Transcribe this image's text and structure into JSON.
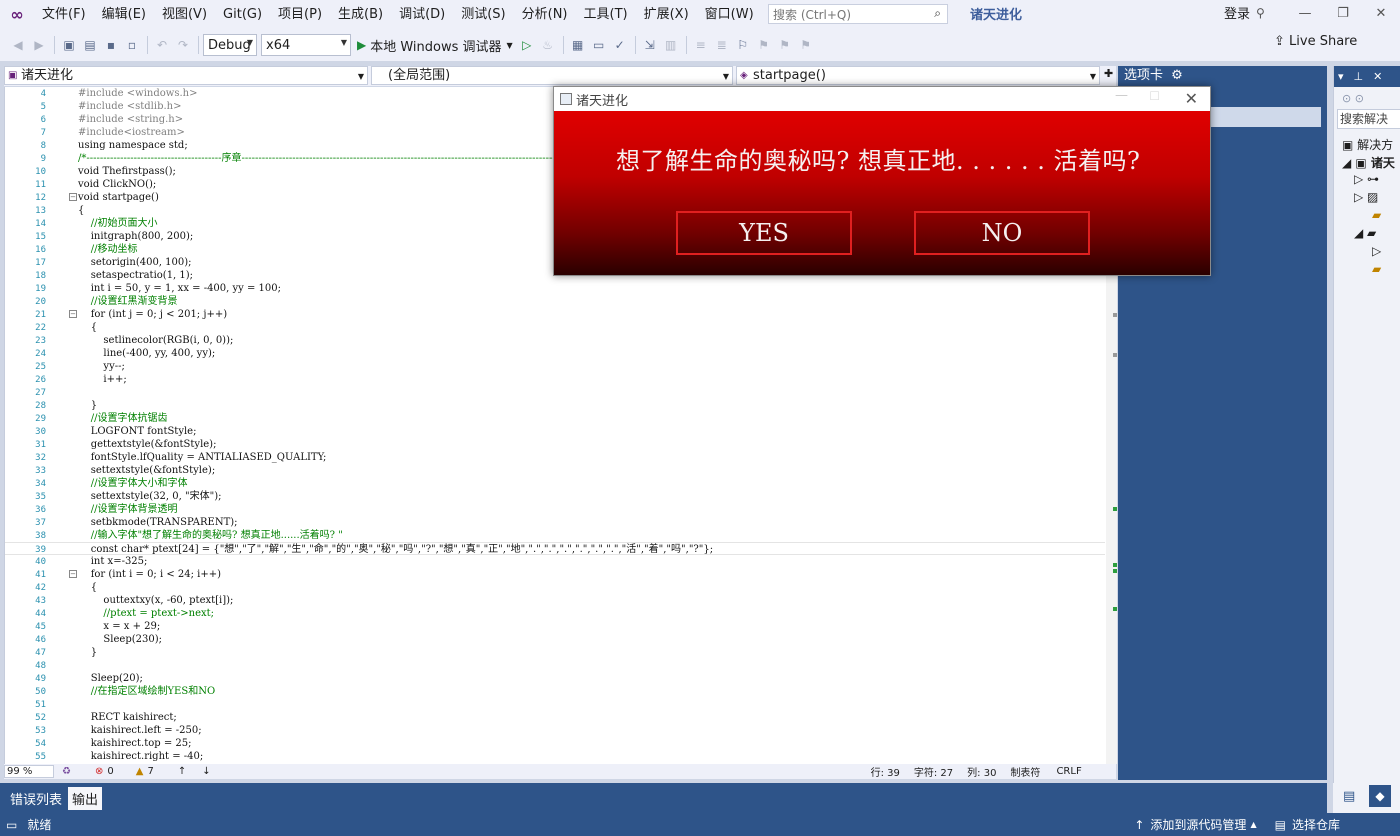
{
  "menubar": {
    "items": [
      "文件(F)",
      "编辑(E)",
      "视图(V)",
      "Git(G)",
      "项目(P)",
      "生成(B)",
      "调试(D)",
      "测试(S)",
      "分析(N)",
      "工具(T)",
      "扩展(X)",
      "窗口(W)",
      "帮助(H)"
    ],
    "search_placeholder": "搜索 (Ctrl+Q)",
    "solution_title": "诸天进化",
    "login_label": "登录"
  },
  "toolbar": {
    "config": "Debug",
    "platform": "x64",
    "run_label": "本地 Windows 调试器",
    "live_share": "Live Share"
  },
  "nav": {
    "project": "诸天进化",
    "scope": "(全局范围)",
    "member": "startpage()"
  },
  "code": {
    "current_line": 39,
    "lines": [
      {
        "n": "4",
        "t": "#include <windows.h>"
      },
      {
        "n": "5",
        "t": "#include <stdlib.h>"
      },
      {
        "n": "6",
        "t": "#include <string.h>"
      },
      {
        "n": "7",
        "t": "#include<iostream>"
      },
      {
        "n": "8",
        "t": "using namespace std;"
      },
      {
        "n": "9",
        "t": "/*----------------------------------------序章------------------------------------------------------------------------------------------------------------"
      },
      {
        "n": "10",
        "t": "void Thefirstpass();"
      },
      {
        "n": "11",
        "t": "void ClickNO();"
      },
      {
        "n": "12",
        "t": "void startpage()"
      },
      {
        "n": "13",
        "t": "{"
      },
      {
        "n": "14",
        "t": "    //初始页面大小"
      },
      {
        "n": "15",
        "t": "    initgraph(800, 200);"
      },
      {
        "n": "16",
        "t": "    //移动坐标"
      },
      {
        "n": "17",
        "t": "    setorigin(400, 100);"
      },
      {
        "n": "18",
        "t": "    setaspectratio(1, 1);"
      },
      {
        "n": "19",
        "t": "    int i = 50, y = 1, xx = -400, yy = 100;"
      },
      {
        "n": "20",
        "t": "    //设置红黑渐变背景"
      },
      {
        "n": "21",
        "t": "    for (int j = 0; j < 201; j++)"
      },
      {
        "n": "22",
        "t": "    {"
      },
      {
        "n": "23",
        "t": "        setlinecolor(RGB(i, 0, 0));"
      },
      {
        "n": "24",
        "t": "        line(-400, yy, 400, yy);"
      },
      {
        "n": "25",
        "t": "        yy--;"
      },
      {
        "n": "26",
        "t": "        i++;"
      },
      {
        "n": "27",
        "t": ""
      },
      {
        "n": "28",
        "t": "    }"
      },
      {
        "n": "29",
        "t": "    //设置字体抗锯齿"
      },
      {
        "n": "30",
        "t": "    LOGFONT fontStyle;"
      },
      {
        "n": "31",
        "t": "    gettextstyle(&fontStyle);"
      },
      {
        "n": "32",
        "t": "    fontStyle.lfQuality = ANTIALIASED_QUALITY;"
      },
      {
        "n": "33",
        "t": "    settextstyle(&fontStyle);"
      },
      {
        "n": "34",
        "t": "    //设置字体大小和字体"
      },
      {
        "n": "35",
        "t": "    settextstyle(32, 0, \"宋体\");"
      },
      {
        "n": "36",
        "t": "    //设置字体背景透明"
      },
      {
        "n": "37",
        "t": "    setbkmode(TRANSPARENT);"
      },
      {
        "n": "38",
        "t": "    //输入字体\"想了解生命的奥秘吗? 想真正地......活着吗? \""
      },
      {
        "n": "39",
        "t": "    const char* ptext[24] = {\"想\",\"了\",\"解\",\"生\",\"命\",\"的\",\"奥\",\"秘\",\"吗\",\"?\",\"想\",\"真\",\"正\",\"地\",\".\",\".\",\".\",\".\",\".\",\".\",\"活\",\"着\",\"吗\",\"?\"};"
      },
      {
        "n": "40",
        "t": "    int x=-325;"
      },
      {
        "n": "41",
        "t": "    for (int i = 0; i < 24; i++)"
      },
      {
        "n": "42",
        "t": "    {"
      },
      {
        "n": "43",
        "t": "        outtextxy(x, -60, ptext[i]);"
      },
      {
        "n": "44",
        "t": "        //ptext = ptext->next;"
      },
      {
        "n": "45",
        "t": "        x = x + 29;"
      },
      {
        "n": "46",
        "t": "        Sleep(230);"
      },
      {
        "n": "47",
        "t": "    }"
      },
      {
        "n": "48",
        "t": ""
      },
      {
        "n": "49",
        "t": "    Sleep(20);"
      },
      {
        "n": "50",
        "t": "    //在指定区域绘制YES和NO"
      },
      {
        "n": "51",
        "t": ""
      },
      {
        "n": "52",
        "t": "    RECT kaishirect;"
      },
      {
        "n": "53",
        "t": "    kaishirect.left = -250;"
      },
      {
        "n": "54",
        "t": "    kaishirect.top = 25;"
      },
      {
        "n": "55",
        "t": "    kaishirect.right = -40;"
      }
    ]
  },
  "editor_status": {
    "zoom": "99 %",
    "errors": "0",
    "warnings": "7",
    "line": "行: 39",
    "char": "字符: 27",
    "col": "列: 30",
    "tabs": "制表符",
    "eol": "CRLF"
  },
  "side_panel": {
    "tabs_title": "选项卡",
    "se_search": "搜索解决",
    "se_root": "解决方",
    "se_item": "诸天"
  },
  "bottom": {
    "tabs": [
      "错误列表",
      "输出"
    ],
    "status_ready": "就绪",
    "add_source_control": "添加到源代码管理",
    "select_repo": "选择仓库"
  },
  "popup": {
    "title": "诸天进化",
    "message": "想了解生命的奥秘吗? 想真正地. . . . . . 活着吗?",
    "yes": "YES",
    "no": "NO"
  }
}
